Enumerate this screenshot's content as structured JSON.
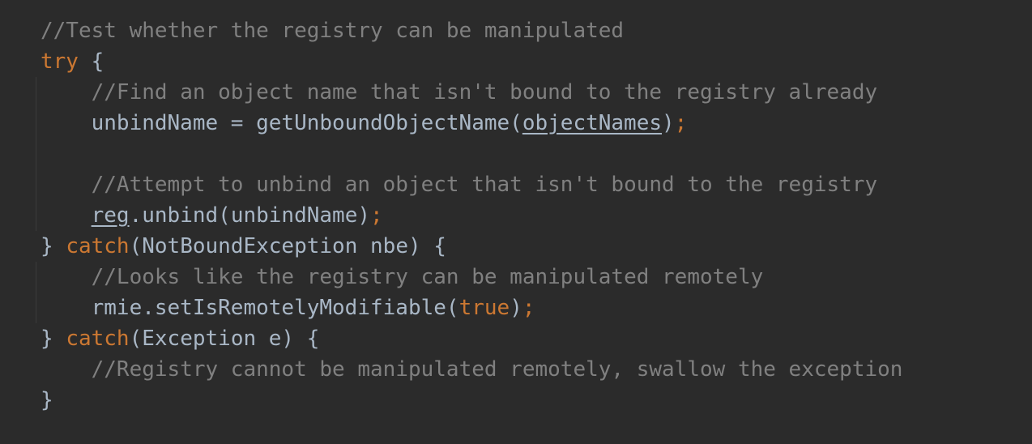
{
  "editor": {
    "background": "#2b2b2b",
    "colors": {
      "text": "#a9b7c6",
      "comment": "#808080",
      "keyword": "#cc7832"
    },
    "lines": [
      [
        {
          "t": "//Test whether the registry can be manipulated",
          "c": "comment"
        }
      ],
      [
        {
          "t": "try",
          "c": "kw"
        },
        {
          "t": " {",
          "c": "plain"
        }
      ],
      [
        {
          "t": "    ",
          "c": "plain"
        },
        {
          "t": "//Find an object name that isn't bound to the registry already",
          "c": "comment"
        }
      ],
      [
        {
          "t": "    unbindName = getUnboundObjectName(",
          "c": "plain"
        },
        {
          "t": "objectNames",
          "c": "plain ul"
        },
        {
          "t": ")",
          "c": "plain"
        },
        {
          "t": ";",
          "c": "kw"
        }
      ],
      [
        {
          "t": "",
          "c": "plain"
        }
      ],
      [
        {
          "t": "    ",
          "c": "plain"
        },
        {
          "t": "//Attempt to unbind an object that isn't bound to the registry",
          "c": "comment"
        }
      ],
      [
        {
          "t": "    ",
          "c": "plain"
        },
        {
          "t": "reg",
          "c": "plain ul"
        },
        {
          "t": ".unbind(unbindName)",
          "c": "plain"
        },
        {
          "t": ";",
          "c": "kw"
        }
      ],
      [
        {
          "t": "} ",
          "c": "plain"
        },
        {
          "t": "catch",
          "c": "kw"
        },
        {
          "t": "(NotBoundException nbe) {",
          "c": "plain"
        }
      ],
      [
        {
          "t": "    ",
          "c": "plain"
        },
        {
          "t": "//Looks like the registry can be manipulated remotely",
          "c": "comment"
        }
      ],
      [
        {
          "t": "    rmie.setIsRemotelyModifiable(",
          "c": "plain"
        },
        {
          "t": "true",
          "c": "kw"
        },
        {
          "t": ")",
          "c": "plain"
        },
        {
          "t": ";",
          "c": "kw"
        }
      ],
      [
        {
          "t": "} ",
          "c": "plain"
        },
        {
          "t": "catch",
          "c": "kw"
        },
        {
          "t": "(Exception e) {",
          "c": "plain"
        }
      ],
      [
        {
          "t": "    ",
          "c": "plain"
        },
        {
          "t": "//Registry cannot be manipulated remotely, swallow the exception",
          "c": "comment"
        }
      ],
      [
        {
          "t": "}",
          "c": "plain"
        }
      ]
    ]
  }
}
